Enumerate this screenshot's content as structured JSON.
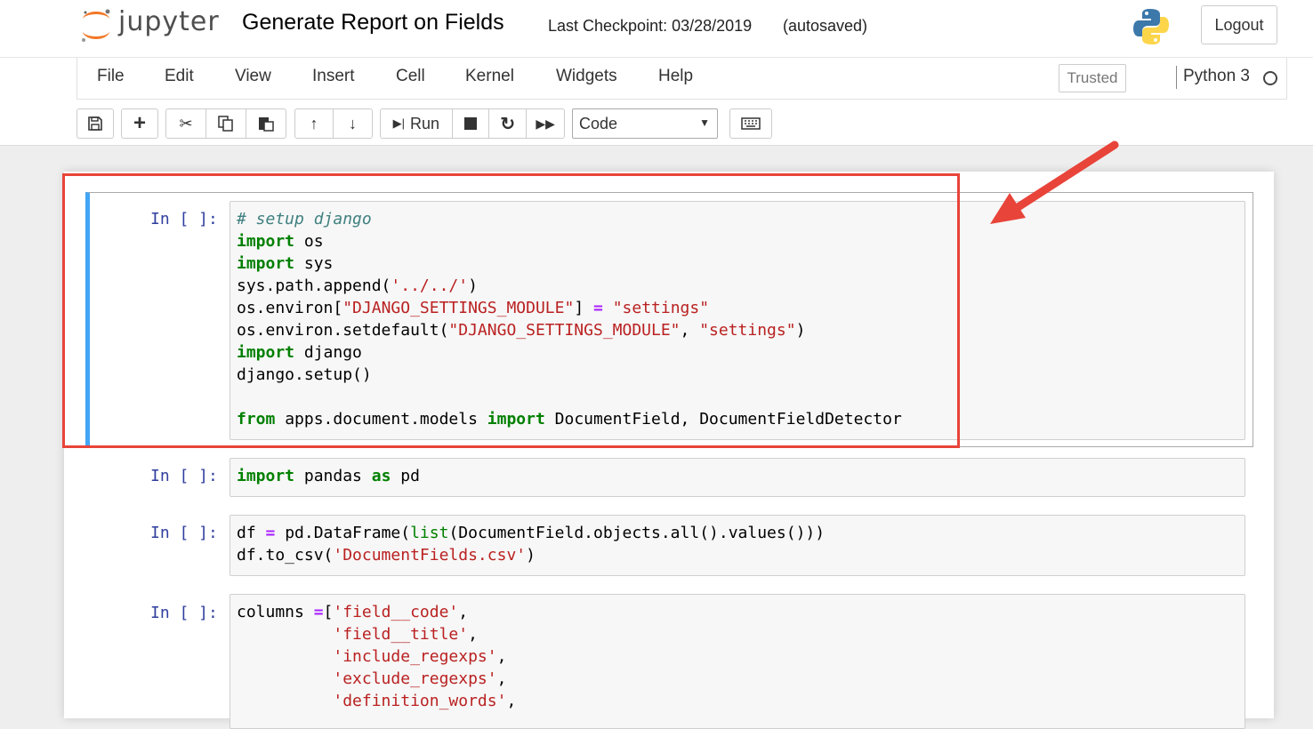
{
  "header": {
    "logo_text": "jupyter",
    "notebook_title": "Generate Report on Fields",
    "checkpoint": "Last Checkpoint: 03/28/2019",
    "autosaved": "(autosaved)",
    "logout_label": "Logout"
  },
  "menu": {
    "items": [
      "File",
      "Edit",
      "View",
      "Insert",
      "Cell",
      "Kernel",
      "Widgets",
      "Help"
    ],
    "trusted": "Trusted",
    "kernel": "Python 3"
  },
  "toolbar": {
    "run_label": "Run",
    "cell_type": "Code"
  },
  "cells": [
    {
      "prompt": "In [ ]:",
      "lines": [
        "# setup django",
        "import os",
        "import sys",
        "sys.path.append('../../')",
        "os.environ[\"DJANGO_SETTINGS_MODULE\"] = \"settings\"",
        "os.environ.setdefault(\"DJANGO_SETTINGS_MODULE\", \"settings\")",
        "import django",
        "django.setup()",
        "",
        "from apps.document.models import DocumentField, DocumentFieldDetector"
      ]
    },
    {
      "prompt": "In [ ]:",
      "lines": [
        "import pandas as pd"
      ]
    },
    {
      "prompt": "In [ ]:",
      "lines": [
        "df = pd.DataFrame(list(DocumentField.objects.all().values()))",
        "df.to_csv('DocumentFields.csv')"
      ]
    },
    {
      "prompt": "In [ ]:",
      "lines": [
        "columns =['field__code',",
        "          'field__title',",
        "          'include_regexps',",
        "          'exclude_regexps',",
        "          'definition_words',"
      ]
    }
  ],
  "colors": {
    "keyword": "#008000",
    "string": "#ba2121",
    "comment": "#408080",
    "prompt": "#303f9f",
    "selected_border": "#42a5f5",
    "annotation": "#e8443a"
  }
}
